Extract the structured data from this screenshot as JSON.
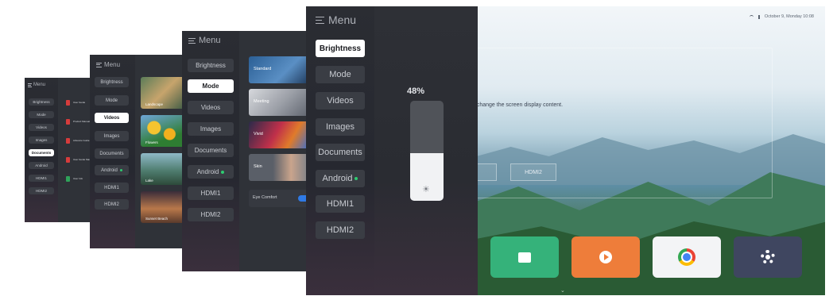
{
  "menu": {
    "title": "Menu",
    "items": [
      "Brightness",
      "Mode",
      "Videos",
      "Images",
      "Documents",
      "Android",
      "HDMI1",
      "HDMI2"
    ]
  },
  "doc_list": [
    "User Guide",
    "Product Manual",
    "Advance Guide",
    "User Guide Manual",
    "User Info"
  ],
  "images_thumbs": [
    "Landscape",
    "Flowers",
    "Lake",
    "Sunset Beach"
  ],
  "mode_options": [
    "Standard",
    "Meeting",
    "Vivid",
    "Skin"
  ],
  "eye_comfort_label": "Eye Comfort",
  "brightness": {
    "percent_label": "48%",
    "level": 0.48
  },
  "status_bar": {
    "datetime": "October 9, Monday 10:08"
  },
  "home": {
    "hint_text": "o change the screen display content.",
    "source_button": "HDMI2",
    "dock": [
      {
        "name": "files",
        "color": "#35b27a",
        "icon": "folder-icon"
      },
      {
        "name": "video",
        "color": "#ee7d3a",
        "icon": "play-icon"
      },
      {
        "name": "browser",
        "color": "#f3f4f6",
        "icon": "chrome-icon"
      },
      {
        "name": "settings",
        "color": "#3f4660",
        "icon": "gear-icon"
      }
    ]
  }
}
